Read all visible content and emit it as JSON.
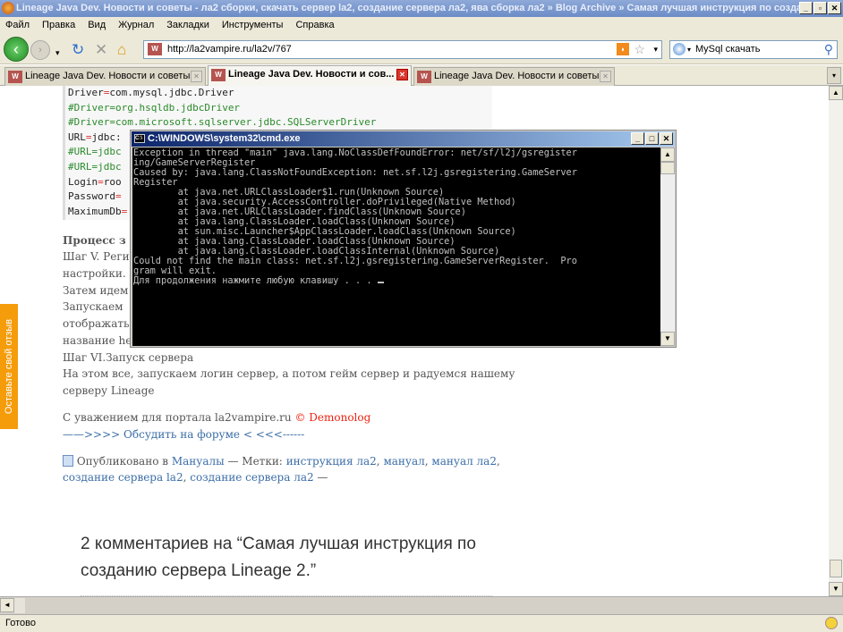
{
  "window": {
    "title": "Lineage Java Dev. Новости и советы - ла2 сборки, скачать сервер la2, создание сервера ла2, ява сборка ла2 » Blog Archive » Самая лучшая инструкция по созда..."
  },
  "menu": [
    "Файл",
    "Правка",
    "Вид",
    "Журнал",
    "Закладки",
    "Инструменты",
    "Справка"
  ],
  "nav": {
    "url": "http://la2vampire.ru/la2v/767",
    "search": "MySql скачать"
  },
  "tabs": [
    {
      "label": "Lineage Java Dev. Новости и советы ..."
    },
    {
      "label": "Lineage Java Dev. Новости и сов..."
    },
    {
      "label": "Lineage Java Dev. Новости и советы ..."
    }
  ],
  "code": [
    {
      "k": "Driver",
      "v": "com.mysql.jdbc.Driver",
      "comment": false
    },
    {
      "k": "#Driver",
      "v": "org.hsqldb.jdbcDriver",
      "comment": true
    },
    {
      "k": "#Driver",
      "v": "com.microsoft.sqlserver.jdbc.SQLServerDriver",
      "comment": true
    },
    {
      "k": "URL",
      "v": "jdbc:",
      "comment": false
    },
    {
      "k": "#URL",
      "v": "jdbc",
      "comment": true
    },
    {
      "k": "#URL",
      "v": "jdbc",
      "comment": true
    },
    {
      "k": "Login",
      "v": "roo",
      "comment": false
    },
    {
      "k": "Password",
      "v": "",
      "comment": false
    },
    {
      "k": "MaximumDb",
      "v": "",
      "comment": false
    }
  ],
  "article": {
    "lines": [
      "Процесс з",
      "Шаг V. Реги",
      "настройки.",
      "Затем идем",
      "Запускаем",
      "отображать",
      "название he",
      "Шаг VI.Запуск сервера",
      "На этом все, запускаем логин сервер, а потом гейм сервер и радуемся нашему",
      "серверу Lineage"
    ],
    "regards": "С уважением для портала la2vampire.ru",
    "author": "© Demonolog",
    "forum_link": "——>>>> Обсудить на форуме < <<<------",
    "published": "Опубликовано в",
    "category": "Мануалы",
    "tags_label": " — Метки:",
    "tags": [
      "инструкция ла2",
      "мануал",
      "мануал ла2",
      "создание сервера la2",
      "создание сервера ла2"
    ],
    "comments_heading_1": "2 комментариев на “Самая лучшая инструкция по",
    "comments_heading_2": "созданию сервера Lineage 2.”"
  },
  "feedback": "Оставьте свой отзыв",
  "cmd": {
    "title": "C:\\WINDOWS\\system32\\cmd.exe",
    "output": "Exception in thread \"main\" java.lang.NoClassDefFoundError: net/sf/l2j/gsregister\ning/GameServerRegister\nCaused by: java.lang.ClassNotFoundException: net.sf.l2j.gsregistering.GameServer\nRegister\n        at java.net.URLClassLoader$1.run(Unknown Source)\n        at java.security.AccessController.doPrivileged(Native Method)\n        at java.net.URLClassLoader.findClass(Unknown Source)\n        at java.lang.ClassLoader.loadClass(Unknown Source)\n        at sun.misc.Launcher$AppClassLoader.loadClass(Unknown Source)\n        at java.lang.ClassLoader.loadClass(Unknown Source)\n        at java.lang.ClassLoader.loadClassInternal(Unknown Source)\nCould not find the main class: net.sf.l2j.gsregistering.GameServerRegister.  Pro\ngram will exit.\nДля продолжения нажмите любую клавишу . . . "
  },
  "status": "Готово"
}
